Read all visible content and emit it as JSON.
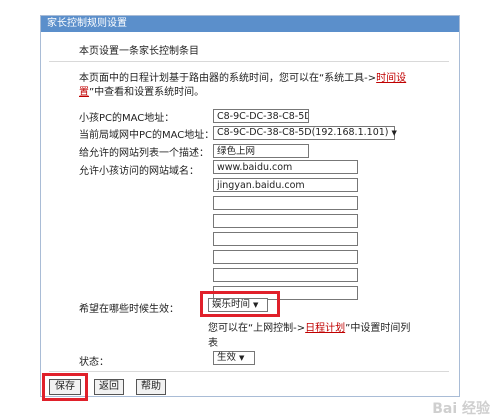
{
  "window": {
    "title": "家长控制规则设置"
  },
  "intro": "本页设置一条家长控制条目",
  "note": {
    "line1": "本页面中的日程计划基于路由器的系统时间，您可以在“系统工具->",
    "link": "时间设",
    "link_cont": "置",
    "line2_rest": "”中查看和设置系统时间。"
  },
  "form": {
    "child_mac_label": "小孩PC的MAC地址：",
    "child_mac_value": "C8-9C-DC-38-C8-5D",
    "current_mac_label": "当前局域网中PC的MAC地址：",
    "current_mac_value": "C8-9C-DC-38-C8-5D(192.168.1.101)",
    "desc_label": "给允许的网站列表一个描述：",
    "desc_value": "绿色上网",
    "domains_label": "允许小孩访问的网站域名：",
    "domains": [
      "www.baidu.com",
      "jingyan.baidu.com",
      "",
      "",
      "",
      "",
      "",
      ""
    ],
    "schedule_label": "希望在哪些时候生效：",
    "schedule_value": "娱乐时间",
    "schedule_hint_pre": "您可以在“上网控制->",
    "schedule_hint_link": "日程计划",
    "schedule_hint_post": "”中设置时间列",
    "schedule_hint_line2": "表",
    "status_label": "状态：",
    "status_value": "生效"
  },
  "buttons": {
    "save": "保存",
    "back": "返回",
    "help": "帮助"
  },
  "watermark": "Bai 经验",
  "colors": {
    "titlebar": "#5b8fcb",
    "highlight": "#e0202a",
    "link": "#c00000"
  }
}
